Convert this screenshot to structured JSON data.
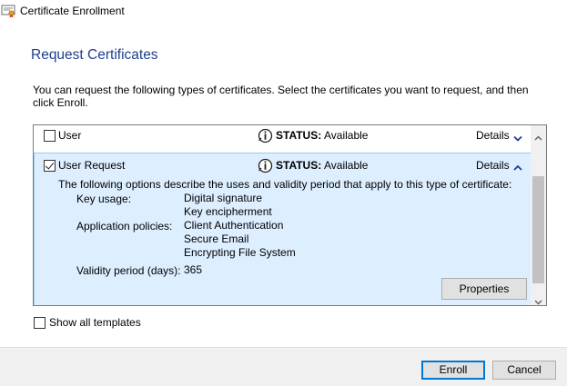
{
  "window": {
    "title": "Certificate Enrollment",
    "icon": "certificate-icon"
  },
  "page": {
    "heading": "Request Certificates",
    "intro": "You can request the following types of certificates. Select the certificates you want to request, and then click Enroll."
  },
  "certificates": [
    {
      "name": "User",
      "checked": false,
      "status_label": "STATUS:",
      "status_value": "Available",
      "details_label": "Details",
      "expanded": false
    },
    {
      "name": "User Request",
      "checked": true,
      "status_label": "STATUS:",
      "status_value": "Available",
      "details_label": "Details",
      "expanded": true,
      "description": "The following options describe the uses and validity period that apply to this type of certificate:",
      "properties": {
        "key_usage_label": "Key usage:",
        "key_usage": [
          "Digital signature",
          "Key encipherment"
        ],
        "app_policies_label": "Application policies:",
        "app_policies": [
          "Client Authentication",
          "Secure Email",
          "Encrypting File System"
        ],
        "validity_label": "Validity period (days):",
        "validity": "365"
      },
      "properties_button": "Properties"
    }
  ],
  "show_all_templates": {
    "label": "Show all templates",
    "checked": false
  },
  "footer": {
    "enroll": "Enroll",
    "cancel": "Cancel"
  },
  "colors": {
    "heading": "#1f3f8f",
    "selected_row_bg": "#ddeeff",
    "selected_row_border": "#99ccee",
    "primary_button_border": "#0078d7"
  }
}
